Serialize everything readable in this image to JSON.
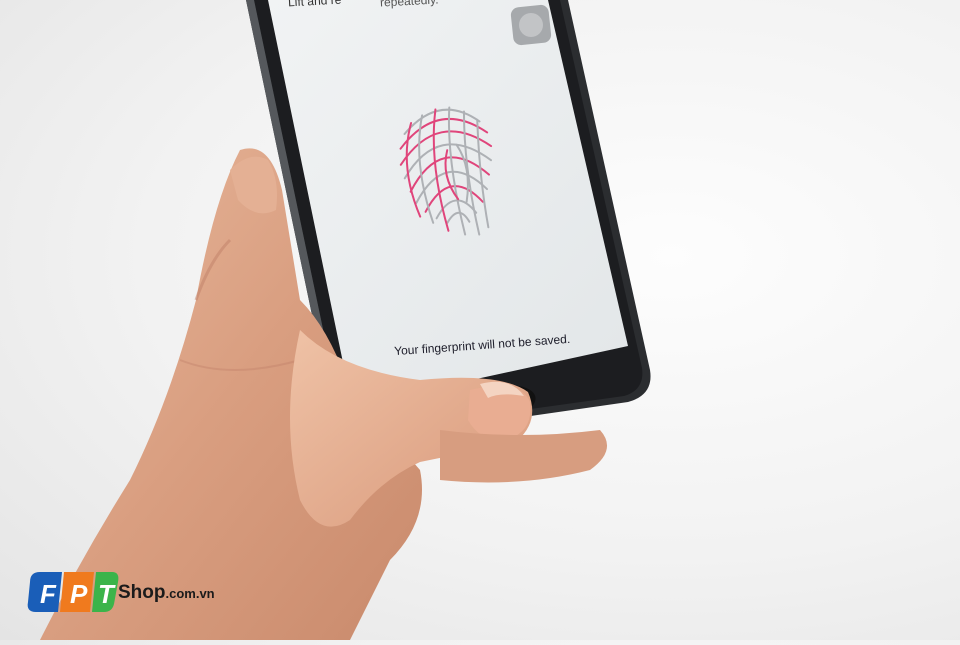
{
  "screen": {
    "top_left_text": "Lift and re",
    "top_right_text": "repeatedly.",
    "message": "Your fingerprint will not be saved."
  },
  "watermark": {
    "brand_letters": [
      "F",
      "P",
      "T"
    ],
    "shop_label": "Shop",
    "domain_suffix": ".com.vn",
    "colors": {
      "f": "#1a5eb8",
      "p": "#f07a1e",
      "t": "#3bb44a"
    }
  },
  "icons": [
    "fingerprint-icon",
    "home-button-icon"
  ],
  "colors": {
    "screen": "#eceff1",
    "phone_frame": "#2b2d30",
    "fingerprint_progress": "#e0457b",
    "fingerprint_lines": "#aeb1b5"
  }
}
